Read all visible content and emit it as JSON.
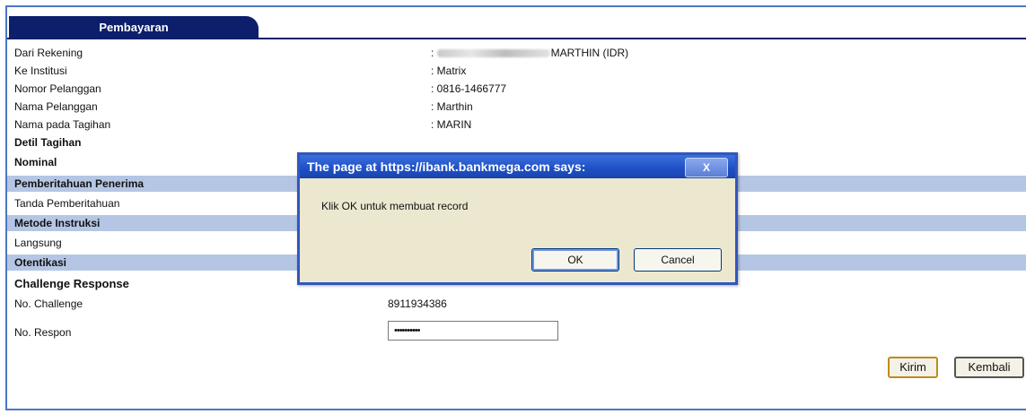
{
  "tab": {
    "label": "Pembayaran"
  },
  "fields": [
    {
      "label": "Dari Rekening",
      "value": "MARTHIN (IDR)",
      "prefix": ": "
    },
    {
      "label": "Ke Institusi",
      "value": ": Matrix"
    },
    {
      "label": "Nomor Pelanggan",
      "value": ": 0816-1466777"
    },
    {
      "label": "Nama Pelanggan",
      "value": ": Marthin"
    },
    {
      "label": "Nama pada Tagihan",
      "value": ": MARIN"
    }
  ],
  "sections": {
    "detil_tagihan": "Detil Tagihan",
    "nominal": "Nominal",
    "pemberitahuan": "Pemberitahuan Penerima",
    "tanda": "Tanda Pemberitahuan",
    "metode": "Metode Instruksi",
    "langsung": "Langsung",
    "otentikasi": "Otentikasi",
    "challenge_response": "Challenge Response",
    "no_challenge_label": "No. Challenge",
    "no_challenge_value": "8911934386",
    "no_respon_label": "No. Respon",
    "no_respon_value": "••••••••••"
  },
  "buttons": {
    "kirim": "Kirim",
    "kembali": "Kembali"
  },
  "dialog": {
    "title": "The page at https://ibank.bankmega.com says:",
    "close": "X",
    "message": "Klik OK untuk membuat record",
    "ok": "OK",
    "cancel": "Cancel"
  }
}
